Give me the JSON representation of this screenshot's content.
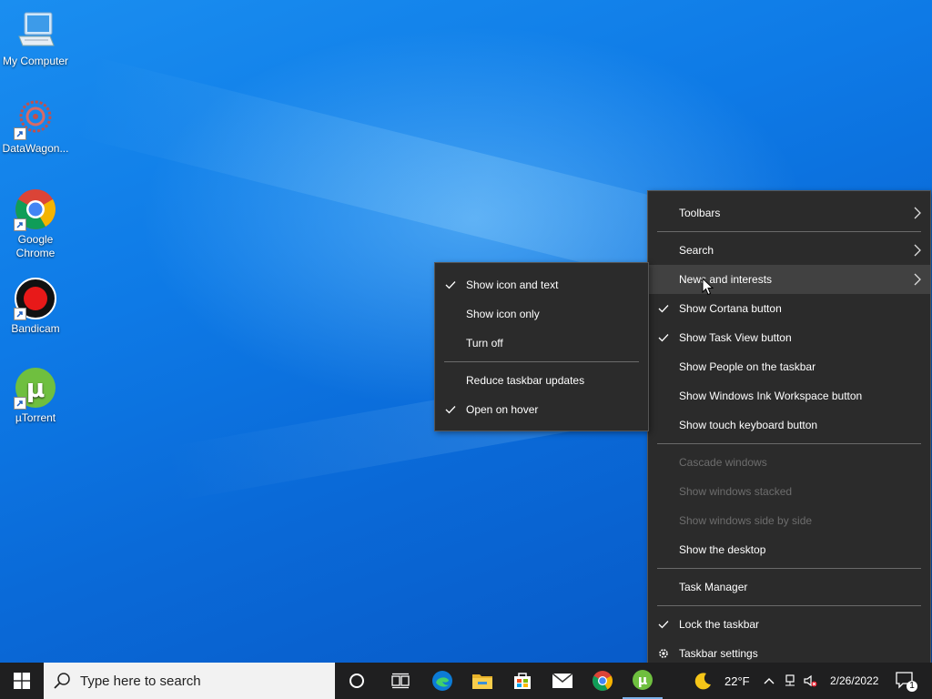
{
  "desktop_icons": [
    {
      "label": "My Computer",
      "icon": "computer-icon"
    },
    {
      "label": "DataWagon...",
      "icon": "datawagon-icon"
    },
    {
      "label": "Google Chrome",
      "icon": "chrome-icon"
    },
    {
      "label": "Bandicam",
      "icon": "bandicam-icon"
    },
    {
      "label": "µTorrent",
      "icon": "utorrent-icon"
    }
  ],
  "context_menu": {
    "items": [
      {
        "label": "Toolbars"
      },
      {
        "label": "Search"
      },
      {
        "label": "News and interests"
      },
      {
        "label": "Show Cortana button"
      },
      {
        "label": "Show Task View button"
      },
      {
        "label": "Show People on the taskbar"
      },
      {
        "label": "Show Windows Ink Workspace button"
      },
      {
        "label": "Show touch keyboard button"
      },
      {
        "label": "Cascade windows"
      },
      {
        "label": "Show windows stacked"
      },
      {
        "label": "Show windows side by side"
      },
      {
        "label": "Show the desktop"
      },
      {
        "label": "Task Manager"
      },
      {
        "label": "Lock the taskbar"
      },
      {
        "label": "Taskbar settings"
      }
    ]
  },
  "submenu": {
    "items": [
      {
        "label": "Show icon and text"
      },
      {
        "label": "Show icon only"
      },
      {
        "label": "Turn off"
      },
      {
        "label": "Reduce taskbar updates"
      },
      {
        "label": "Open on hover"
      }
    ]
  },
  "taskbar": {
    "search_placeholder": "Type here to search",
    "pinned_apps": [
      "edge-icon",
      "file-explorer-icon",
      "store-icon",
      "mail-icon",
      "chrome-icon",
      "utorrent-icon"
    ],
    "weather_temp": "22°F",
    "date": "2/26/2022",
    "notification_count": "1"
  },
  "colors": {
    "menu_bg": "#2b2b2b",
    "menu_hover": "#414141",
    "taskbar_bg": "#1f1f20",
    "disabled_text": "#6d6d6d"
  }
}
